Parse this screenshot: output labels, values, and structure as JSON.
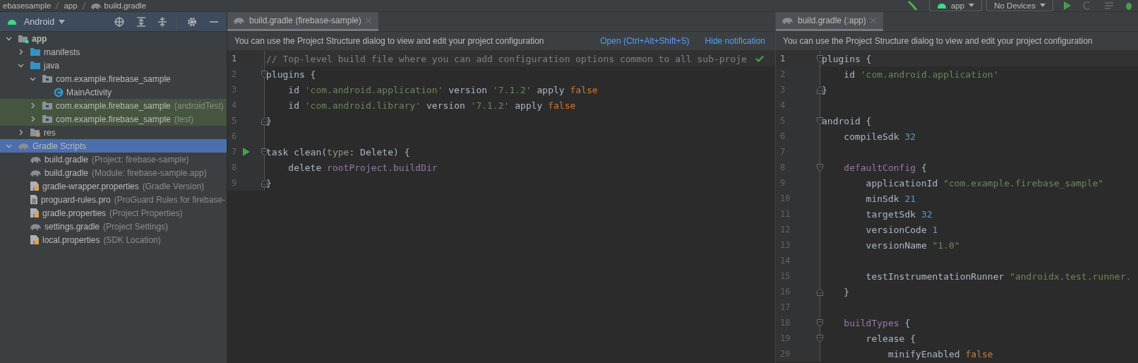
{
  "toolbar": {
    "breadcrumbs": [
      {
        "label": "ebasesample",
        "kind": "folder"
      },
      {
        "label": "app",
        "kind": "folder"
      },
      {
        "label": "build.gradle",
        "kind": "gradle"
      }
    ],
    "run_config": "app",
    "device": "No Devices"
  },
  "project_panel": {
    "view": "Android",
    "tree": [
      {
        "label": "app",
        "kind": "module",
        "expanded": true,
        "selected": false,
        "test": false,
        "children": [
          {
            "label": "manifests",
            "kind": "folder",
            "expanded": false,
            "selected": false,
            "test": false
          },
          {
            "label": "java",
            "kind": "folder",
            "expanded": true,
            "selected": false,
            "test": false,
            "children": [
              {
                "label": "com.example.firebase_sample",
                "kind": "package",
                "expanded": true,
                "selected": false,
                "test": false,
                "children": [
                  {
                    "label": "MainActivity",
                    "kind": "class",
                    "selected": false,
                    "test": false
                  }
                ]
              },
              {
                "label": "com.example.firebase_sample",
                "hint": "(androidTest)",
                "kind": "package",
                "expanded": false,
                "selected": false,
                "test": true
              },
              {
                "label": "com.example.firebase_sample",
                "hint": "(test)",
                "kind": "package",
                "expanded": false,
                "selected": false,
                "test": true
              }
            ]
          },
          {
            "label": "res",
            "kind": "res",
            "expanded": false,
            "selected": false,
            "test": false
          }
        ]
      },
      {
        "label": "Gradle Scripts",
        "kind": "gradle",
        "expanded": true,
        "selected": true,
        "test": false,
        "children": [
          {
            "label": "build.gradle",
            "hint": "(Project: firebase-sample)",
            "kind": "gradle",
            "selected": false,
            "test": false
          },
          {
            "label": "build.gradle",
            "hint": "(Module: firebase-sample.app)",
            "kind": "gradle",
            "selected": false,
            "test": false
          },
          {
            "label": "gradle-wrapper.properties",
            "hint": "(Gradle Version)",
            "kind": "properties",
            "selected": false,
            "test": false
          },
          {
            "label": "proguard-rules.pro",
            "hint": "(ProGuard Rules for firebase-",
            "kind": "file",
            "selected": false,
            "test": false
          },
          {
            "label": "gradle.properties",
            "hint": "(Project Properties)",
            "kind": "properties",
            "selected": false,
            "test": false
          },
          {
            "label": "settings.gradle",
            "hint": "(Project Settings)",
            "kind": "gradle",
            "selected": false,
            "test": false
          },
          {
            "label": "local.properties",
            "hint": "(SDK Location)",
            "kind": "properties",
            "selected": false,
            "test": false
          }
        ]
      }
    ]
  },
  "editors": [
    {
      "tabs": [
        {
          "label": "build.gradle (firebase-sample)",
          "selected": true
        }
      ],
      "notification": {
        "text": "You can use the Project Structure dialog to view and edit your project configuration",
        "links": [
          "Open (Ctrl+Alt+Shift+S)",
          "Hide notification"
        ]
      },
      "lines": [
        {
          "number": "1",
          "current": true,
          "tokens": [
            {
              "text": "// Top-level build file where you can add configuration options common to all sub-proje",
              "kind": "comment"
            }
          ]
        },
        {
          "number": "2",
          "current": false,
          "fold_start": true,
          "tokens": [
            {
              "text": "plugins {",
              "kind": "plain"
            }
          ]
        },
        {
          "number": "3",
          "current": false,
          "tokens": [
            {
              "text": "    id ",
              "kind": "plain"
            },
            {
              "text": "'com.android.application'",
              "kind": "string"
            },
            {
              "text": " version ",
              "kind": "plain"
            },
            {
              "text": "'7.1.2'",
              "kind": "string"
            },
            {
              "text": " apply ",
              "kind": "plain"
            },
            {
              "text": "false",
              "kind": "keyword"
            }
          ]
        },
        {
          "number": "4",
          "current": false,
          "tokens": [
            {
              "text": "    id ",
              "kind": "plain"
            },
            {
              "text": "'com.android.library'",
              "kind": "string"
            },
            {
              "text": " version ",
              "kind": "plain"
            },
            {
              "text": "'7.1.2'",
              "kind": "string"
            },
            {
              "text": " apply ",
              "kind": "plain"
            },
            {
              "text": "false",
              "kind": "keyword"
            }
          ]
        },
        {
          "number": "5",
          "current": false,
          "fold_end": true,
          "tokens": [
            {
              "text": "}",
              "kind": "plain"
            }
          ]
        },
        {
          "number": "6",
          "current": false
        },
        {
          "number": "7",
          "current": false,
          "fold_start": true,
          "run": true,
          "tokens": [
            {
              "text": "task clean(",
              "kind": "plain"
            },
            {
              "text": "type",
              "kind": "param"
            },
            {
              "text": ": Delete) {",
              "kind": "plain"
            }
          ]
        },
        {
          "number": "8",
          "current": false,
          "tokens": [
            {
              "text": "    delete ",
              "kind": "plain"
            },
            {
              "text": "rootProject.buildDir",
              "kind": "field"
            }
          ]
        },
        {
          "number": "9",
          "current": false,
          "fold_end": true,
          "tokens": [
            {
              "text": "}",
              "kind": "plain"
            }
          ]
        }
      ]
    },
    {
      "tabs": [
        {
          "label": "build.gradle (:app)",
          "selected": true
        }
      ],
      "notification": {
        "text": "You can use the Project Structure dialog to view and edit your project configuration"
      },
      "lines": [
        {
          "number": "1",
          "current": true,
          "fold_start": true,
          "tokens": [
            {
              "text": "plugins {",
              "kind": "plain"
            }
          ]
        },
        {
          "number": "2",
          "current": false,
          "tokens": [
            {
              "text": "    id ",
              "kind": "plain"
            },
            {
              "text": "'com.android.application'",
              "kind": "string"
            }
          ]
        },
        {
          "number": "3",
          "current": false,
          "fold_end": true,
          "tokens": [
            {
              "text": "}",
              "kind": "plain"
            }
          ]
        },
        {
          "number": "4",
          "current": false
        },
        {
          "number": "5",
          "current": false,
          "fold_start": true,
          "tokens": [
            {
              "text": "android {",
              "kind": "plain"
            }
          ]
        },
        {
          "number": "6",
          "current": false,
          "tokens": [
            {
              "text": "    compileSdk ",
              "kind": "plain"
            },
            {
              "text": "32",
              "kind": "number"
            }
          ]
        },
        {
          "number": "7",
          "current": false
        },
        {
          "number": "8",
          "current": false,
          "fold_start": true,
          "tokens": [
            {
              "text": "    defaultConfig",
              "kind": "field"
            },
            {
              "text": " {",
              "kind": "plain"
            }
          ]
        },
        {
          "number": "9",
          "current": false,
          "tokens": [
            {
              "text": "        applicationId ",
              "kind": "plain"
            },
            {
              "text": "\"com.example.firebase_sample\"",
              "kind": "string"
            }
          ]
        },
        {
          "number": "10",
          "current": false,
          "tokens": [
            {
              "text": "        minSdk ",
              "kind": "plain"
            },
            {
              "text": "21",
              "kind": "number"
            }
          ]
        },
        {
          "number": "11",
          "current": false,
          "tokens": [
            {
              "text": "        targetSdk ",
              "kind": "plain"
            },
            {
              "text": "32",
              "kind": "number"
            }
          ]
        },
        {
          "number": "12",
          "current": false,
          "tokens": [
            {
              "text": "        versionCode ",
              "kind": "plain"
            },
            {
              "text": "1",
              "kind": "number"
            }
          ]
        },
        {
          "number": "13",
          "current": false,
          "tokens": [
            {
              "text": "        versionName ",
              "kind": "plain"
            },
            {
              "text": "\"1.0\"",
              "kind": "string"
            }
          ]
        },
        {
          "number": "14",
          "current": false
        },
        {
          "number": "15",
          "current": false,
          "tokens": [
            {
              "text": "        testInstrumentationRunner ",
              "kind": "plain"
            },
            {
              "text": "\"androidx.test.runner.",
              "kind": "string"
            }
          ]
        },
        {
          "number": "16",
          "current": false,
          "fold_end": true,
          "tokens": [
            {
              "text": "    }",
              "kind": "plain"
            }
          ]
        },
        {
          "number": "17",
          "current": false
        },
        {
          "number": "18",
          "current": false,
          "fold_start": true,
          "tokens": [
            {
              "text": "    buildTypes",
              "kind": "field"
            },
            {
              "text": " {",
              "kind": "plain"
            }
          ]
        },
        {
          "number": "19",
          "current": false,
          "fold_start": true,
          "tokens": [
            {
              "text": "        release {",
              "kind": "plain"
            }
          ]
        },
        {
          "number": "20",
          "current": false,
          "tokens": [
            {
              "text": "            minifyEnabled ",
              "kind": "plain"
            },
            {
              "text": "false",
              "kind": "keyword"
            }
          ]
        }
      ]
    }
  ]
}
